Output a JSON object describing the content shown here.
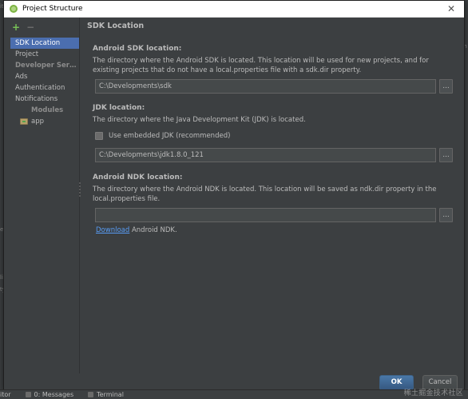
{
  "window": {
    "title": "Project Structure",
    "close_glyph": "✕"
  },
  "sidebar": {
    "toolbar": {
      "add_glyph": "+",
      "remove_glyph": "−"
    },
    "items": [
      {
        "label": "SDK Location",
        "type": "item",
        "selected": true
      },
      {
        "label": "Project",
        "type": "item",
        "selected": false
      },
      {
        "label": "Developer Servic...",
        "type": "header",
        "selected": false
      },
      {
        "label": "Ads",
        "type": "item",
        "selected": false
      },
      {
        "label": "Authentication",
        "type": "item",
        "selected": false
      },
      {
        "label": "Notifications",
        "type": "item",
        "selected": false
      },
      {
        "label": "Modules",
        "type": "group",
        "selected": false
      },
      {
        "label": "app",
        "type": "module",
        "selected": false
      }
    ]
  },
  "main": {
    "title": "SDK Location",
    "android_sdk": {
      "title": "Android SDK location:",
      "description": "The directory where the Android SDK is located. This location will be used for new projects, and for existing projects that do not have a local.properties file with a sdk.dir property.",
      "path": "C:\\Developments\\sdk",
      "browse_label": "..."
    },
    "jdk": {
      "title": "JDK location:",
      "description": "The directory where the Java Development Kit (JDK) is located.",
      "checkbox_label": "Use embedded JDK (recommended)",
      "path": "C:\\Developments\\jdk1.8.0_121",
      "browse_label": "..."
    },
    "ndk": {
      "title": "Android NDK location:",
      "description": "The directory where the Android NDK is located. This location will be saved as ndk.dir property in the local.properties file.",
      "path": "",
      "browse_label": "...",
      "download_link": "Download",
      "download_suffix": " Android NDK."
    }
  },
  "footer": {
    "ok_label": "OK",
    "cancel_label": "Cancel"
  },
  "background": {
    "bottom_bar_left": "itor",
    "bottom_bar_messages": "0: Messages",
    "bottom_bar_terminal": "Terminal",
    "left_fragments": [
      "iti",
      "er",
      "li",
      "ty"
    ],
    "right_fragments": [
      "m",
      "s"
    ]
  },
  "watermark": "稀土掘金技术社区",
  "colors": {
    "accent": "#4b6eaf",
    "link": "#589df6",
    "ok_button": "#4a78a8",
    "panel": "#3c3f41"
  },
  "icons": {
    "titlebar": "android-icon",
    "close": "close-icon",
    "add": "add-icon",
    "remove": "remove-icon",
    "module": "folder-icon"
  }
}
